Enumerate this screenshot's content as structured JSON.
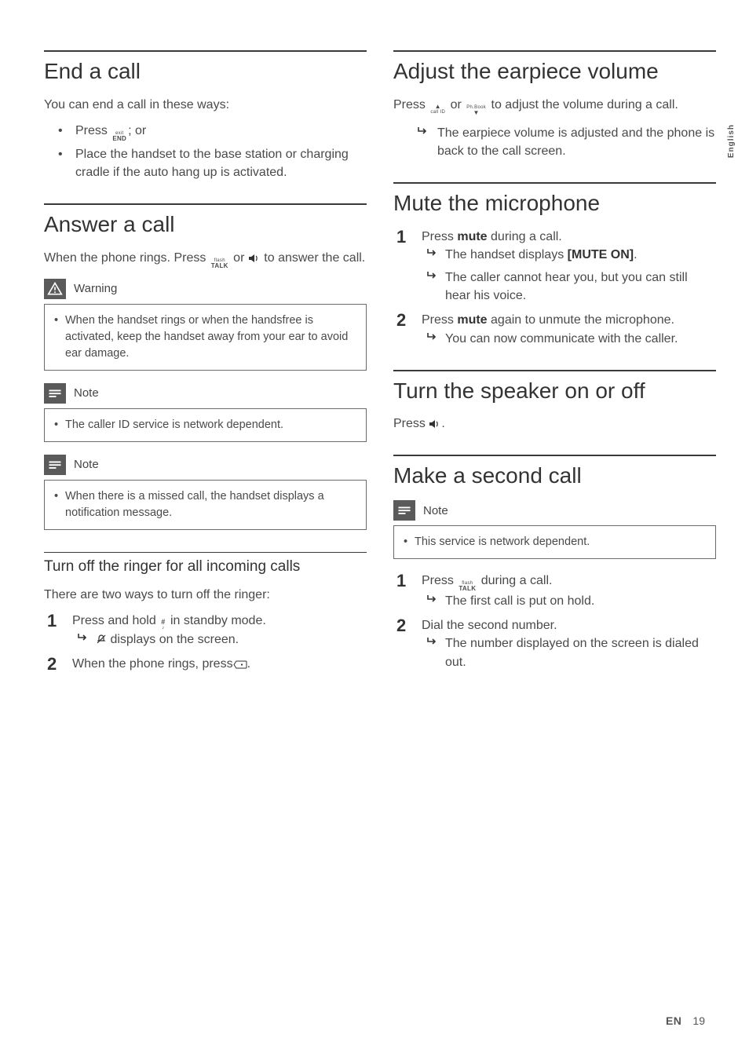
{
  "lang_tab": "English",
  "footer": {
    "lang": "EN",
    "page": "19"
  },
  "left": {
    "end_call": {
      "title": "End a call",
      "intro": "You can end a call in these ways:",
      "b1_a": "Press ",
      "b1_b": "; or",
      "b2": "Place the handset to the base station or charging cradle if the auto hang up is activated.",
      "key_end_top": "exit",
      "key_end_bot": "END"
    },
    "answer": {
      "title": "Answer a call",
      "intro_a": "When the phone rings. Press ",
      "intro_b": " or ",
      "intro_c": " to answer the call.",
      "key_talk_top": "flash",
      "key_talk_bot": "TALK",
      "warn_title": "Warning",
      "warn_item": "When the handset rings or when the handsfree is activated, keep the handset away from your ear to avoid ear damage.",
      "note1_title": "Note",
      "note1_item": "The caller ID service is network dependent.",
      "note2_title": "Note",
      "note2_item": "When there is a missed call, the handset displays a notification message."
    },
    "ringer": {
      "title": "Turn off the ringer for all incoming calls",
      "intro": "There are two ways to turn off the ringer:",
      "s1_a": "Press and hold ",
      "s1_b": " in standby mode.",
      "s1_res_a": " displays on the screen.",
      "s2_a": "When the phone rings, press",
      "s2_b": ".",
      "key_hash_top": "#",
      "key_hash_bot": "♪"
    }
  },
  "right": {
    "volume": {
      "title": "Adjust the earpiece volume",
      "intro_a": "Press ",
      "intro_b": " or ",
      "intro_c": " to adjust the volume during a call.",
      "res": "The earpiece volume is adjusted and the phone is back to the call screen.",
      "key_up_top": "▲",
      "key_up_bot": "call ID",
      "key_dn_top": "Ph.Book",
      "key_dn_bot": "▼"
    },
    "mute": {
      "title": "Mute the microphone",
      "s1_a": "Press ",
      "s1_b": "mute",
      "s1_c": " during a call.",
      "s1_r1_a": "The handset displays ",
      "s1_r1_b": "[MUTE ON]",
      "s1_r1_c": ".",
      "s1_r2": "The caller cannot hear you, but you can still hear his voice.",
      "s2_a": "Press ",
      "s2_b": "mute",
      "s2_c": " again to unmute the microphone.",
      "s2_r1": "You can now communicate with the caller."
    },
    "speaker": {
      "title": "Turn the speaker on or off",
      "intro_a": "Press ",
      "intro_b": "."
    },
    "second": {
      "title": "Make a second call",
      "note_title": "Note",
      "note_item": "This service is network dependent.",
      "s1_a": "Press ",
      "s1_b": " during a call.",
      "s1_r": "The first call is put on hold.",
      "s2": "Dial the second number.",
      "s2_r": "The number displayed on the screen is dialed out.",
      "key_talk_top": "flash",
      "key_talk_bot": "TALK"
    }
  }
}
